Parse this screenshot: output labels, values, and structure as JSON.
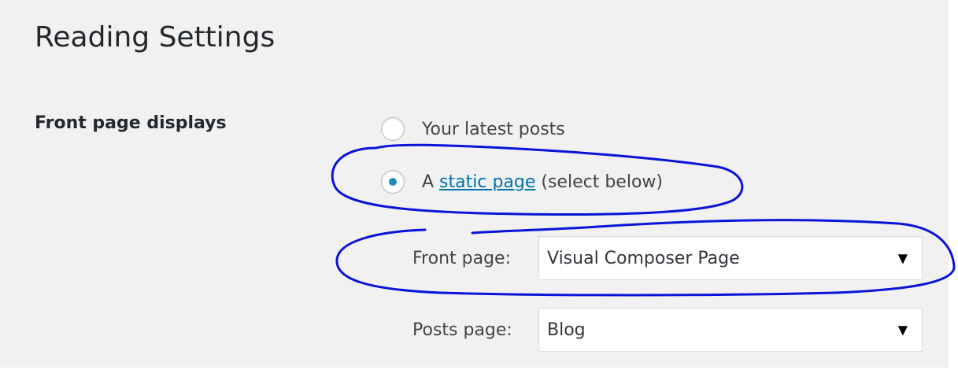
{
  "page": {
    "title": "Reading Settings"
  },
  "front_page_displays": {
    "label": "Front page displays",
    "options": [
      {
        "prefix": "",
        "link": "",
        "suffix": "Your latest posts",
        "checked": false
      },
      {
        "prefix": "A ",
        "link": "static page",
        "suffix": " (select below)",
        "checked": true
      }
    ],
    "front_page": {
      "label": "Front page:",
      "selected": "Visual Composer Page"
    },
    "posts_page": {
      "label": "Posts page:",
      "selected": "Blog"
    }
  },
  "icons": {
    "dropdown_arrow": "▼"
  },
  "colors": {
    "background": "#f1f1f1",
    "link": "#0073aa",
    "radio_dot": "#1e8cbe",
    "annotation_ink": "#0a14d8"
  }
}
